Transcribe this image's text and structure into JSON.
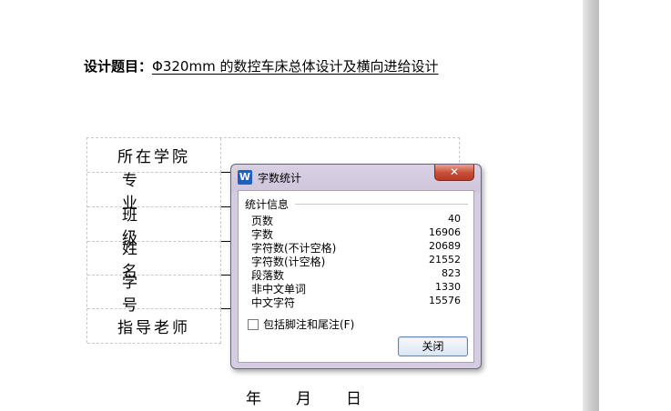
{
  "document": {
    "title_label": "设计题目：",
    "title_text": "Φ320mm 的数控车床总体设计及横向进给设计",
    "table_labels": [
      "所在学院",
      "专业",
      "班级",
      "姓名",
      "学号",
      "指导老师"
    ],
    "date_labels": [
      "年",
      "月",
      "日"
    ]
  },
  "dialog": {
    "title": "字数统计",
    "logo": "W",
    "close_icon": "✕",
    "group_label": "统计信息",
    "stats": [
      {
        "label": "页数",
        "value": "40"
      },
      {
        "label": "字数",
        "value": "16906"
      },
      {
        "label": "字符数(不计空格)",
        "value": "20689"
      },
      {
        "label": "字符数(计空格)",
        "value": "21552"
      },
      {
        "label": "段落数",
        "value": "823"
      },
      {
        "label": "非中文单词",
        "value": "1330"
      },
      {
        "label": "中文字符",
        "value": "15576"
      }
    ],
    "footnote_label": "包括脚注和尾注(F)",
    "footnote_checked": false,
    "close_button_label": "关闭"
  }
}
